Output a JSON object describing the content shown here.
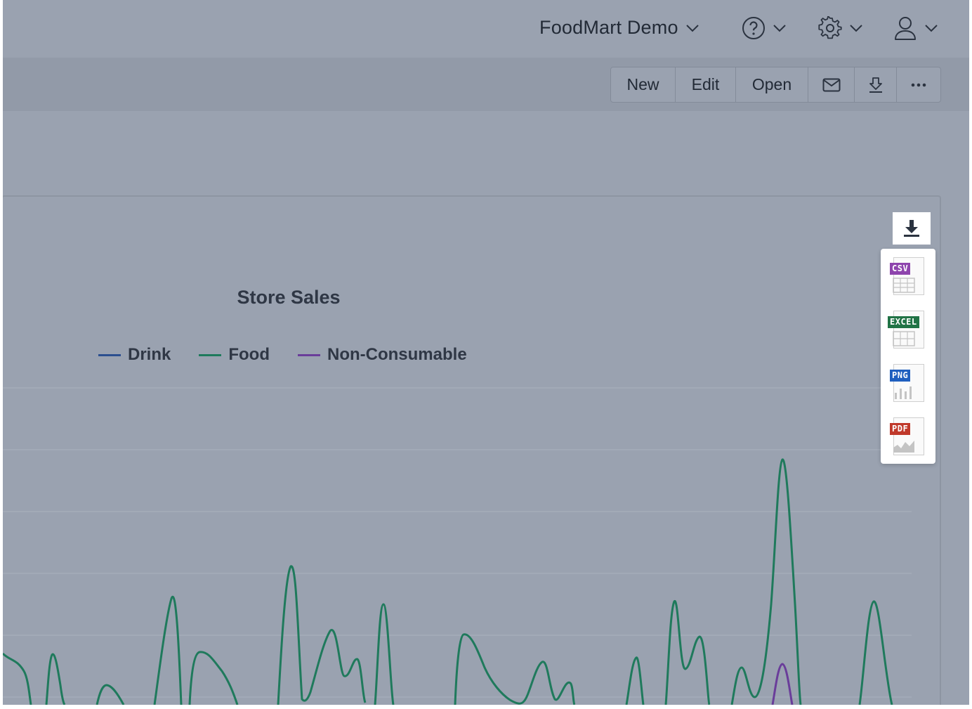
{
  "header": {
    "project_name": "FoodMart Demo"
  },
  "toolbar": {
    "new_label": "New",
    "edit_label": "Edit",
    "open_label": "Open",
    "icons": [
      "mail-icon",
      "download-icon",
      "more-icon"
    ]
  },
  "chart_data": {
    "type": "line",
    "title": "Store Sales",
    "series": [
      {
        "name": "Drink",
        "color": "#2b4f8f"
      },
      {
        "name": "Food",
        "color": "#1f7a5c"
      },
      {
        "name": "Non-Consumable",
        "color": "#6a3d9a"
      }
    ],
    "grid": true,
    "legend": "top"
  },
  "download_menu": {
    "items": [
      {
        "label": "CSV",
        "color": "#8e44ad"
      },
      {
        "label": "EXCEL",
        "color": "#217346"
      },
      {
        "label": "PNG",
        "color": "#1f5fbf"
      },
      {
        "label": "PDF",
        "color": "#c0392b"
      }
    ]
  }
}
